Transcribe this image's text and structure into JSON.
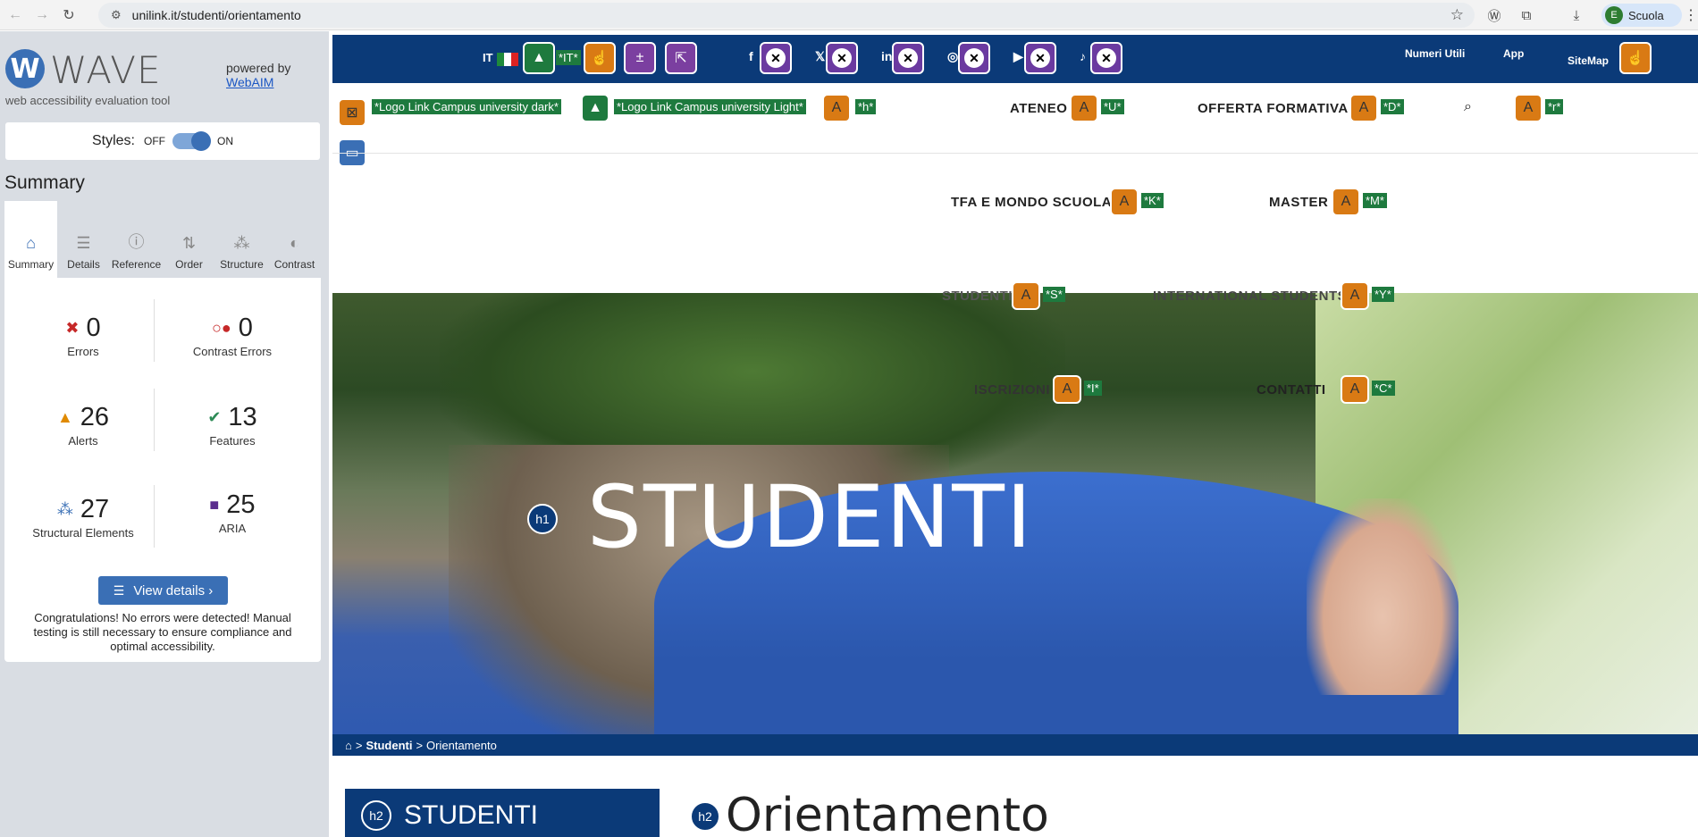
{
  "browser": {
    "url": "unilink.it/studenti/orientamento",
    "profile": "Scuola",
    "profile_initial": "E"
  },
  "wave": {
    "logo_letter": "W",
    "title": "WAVE",
    "subtitle": "web accessibility evaluation tool",
    "powered_by": "powered by",
    "webaim": "WebAIM",
    "styles_label": "Styles:",
    "styles_off": "OFF",
    "styles_on": "ON",
    "summary_title": "Summary",
    "tabs": [
      "Summary",
      "Details",
      "Reference",
      "Order",
      "Structure",
      "Contrast"
    ],
    "stats": {
      "errors": {
        "value": "0",
        "label": "Errors"
      },
      "contrast_errors": {
        "value": "0",
        "label": "Contrast Errors"
      },
      "alerts": {
        "value": "26",
        "label": "Alerts"
      },
      "features": {
        "value": "13",
        "label": "Features"
      },
      "structural": {
        "value": "27",
        "label": "Structural Elements"
      },
      "aria": {
        "value": "25",
        "label": "ARIA"
      }
    },
    "view_details": "View details ›",
    "congrats": "Congratulations! No errors were detected! Manual testing is still necessary to ensure compliance and optimal accessibility."
  },
  "site": {
    "lang": "IT",
    "lang_tag": "*IT*",
    "top_links": {
      "numeri": "Numeri Utili",
      "app": "App",
      "sitemap": "SiteMap"
    },
    "logo_dark": "*Logo Link Campus university dark*",
    "logo_light": "*Logo Link Campus university Light*",
    "tag_h": "*h*",
    "nav": [
      {
        "label": "ATENEO",
        "tag": "*U*"
      },
      {
        "label": "OFFERTA FORMATIVA",
        "tag": "*D*"
      },
      {
        "label": "TFA E MONDO SCUOLA",
        "tag": "*K*"
      },
      {
        "label": "MASTER",
        "tag": "*M*"
      },
      {
        "label": "STUDENTI",
        "tag": "*S*"
      },
      {
        "label": "INTERNATIONAL STUDENTS",
        "tag": "*Y*"
      },
      {
        "label": "ISCRIZIONI",
        "tag": "*I*"
      },
      {
        "label": "CONTATTI",
        "tag": "*C*"
      }
    ],
    "search_tag": "*r*",
    "hero_title": "STUDENTI",
    "h1": "h1",
    "h2": "h2",
    "breadcrumb": {
      "sep": ">",
      "studenti": "Studenti",
      "current": "Orientamento"
    },
    "side_title": "STUDENTI",
    "page_title": "Orientamento"
  }
}
